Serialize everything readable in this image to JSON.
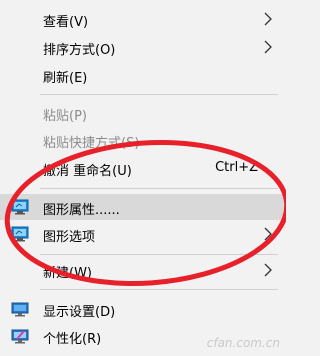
{
  "menu": {
    "items": [
      {
        "label": "查看(V)",
        "has_submenu": true,
        "disabled": false
      },
      {
        "label": "排序方式(O)",
        "has_submenu": true,
        "disabled": false
      },
      {
        "label": "刷新(E)",
        "has_submenu": false,
        "disabled": false
      },
      {
        "label": "粘贴(P)",
        "has_submenu": false,
        "disabled": true
      },
      {
        "label": "粘贴快捷方式(S)",
        "has_submenu": false,
        "disabled": true
      },
      {
        "label": "撤消 重命名(U)",
        "shortcut": "Ctrl+Z",
        "has_submenu": false,
        "disabled": false
      },
      {
        "label": "图形属性......",
        "icon": "graphics-properties-icon",
        "has_submenu": false,
        "disabled": false,
        "highlighted": true
      },
      {
        "label": "图形选项",
        "icon": "graphics-options-icon",
        "has_submenu": true,
        "disabled": false
      },
      {
        "label": "新建(W)",
        "has_submenu": true,
        "disabled": false
      },
      {
        "label": "显示设置(D)",
        "icon": "display-settings-icon",
        "has_submenu": false,
        "disabled": false
      },
      {
        "label": "个性化(R)",
        "icon": "personalize-icon",
        "has_submenu": false,
        "disabled": false
      }
    ]
  },
  "watermark": "cfan.com.cn",
  "colors": {
    "annotation_circle": "#e8202a",
    "hover_bg": "#d9d9d9",
    "menu_bg": "#f2f2f2"
  }
}
